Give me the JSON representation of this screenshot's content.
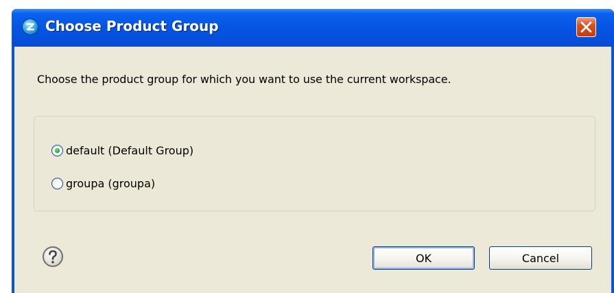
{
  "window": {
    "title": "Choose Product Group",
    "icon": "product-icon",
    "close_icon": "close-icon"
  },
  "dialog": {
    "message": "Choose the product group for which you want to use the current workspace.",
    "options": [
      {
        "label": "default (Default Group)",
        "selected": true
      },
      {
        "label": "groupa (groupa)",
        "selected": false
      }
    ],
    "help_icon": "help-icon",
    "ok_label": "OK",
    "cancel_label": "Cancel"
  },
  "colors": {
    "title_bar": "#0550dc",
    "dialog_bg": "#ece9d8",
    "close_button": "#d9501e",
    "radio_selected": "#22a53b"
  }
}
